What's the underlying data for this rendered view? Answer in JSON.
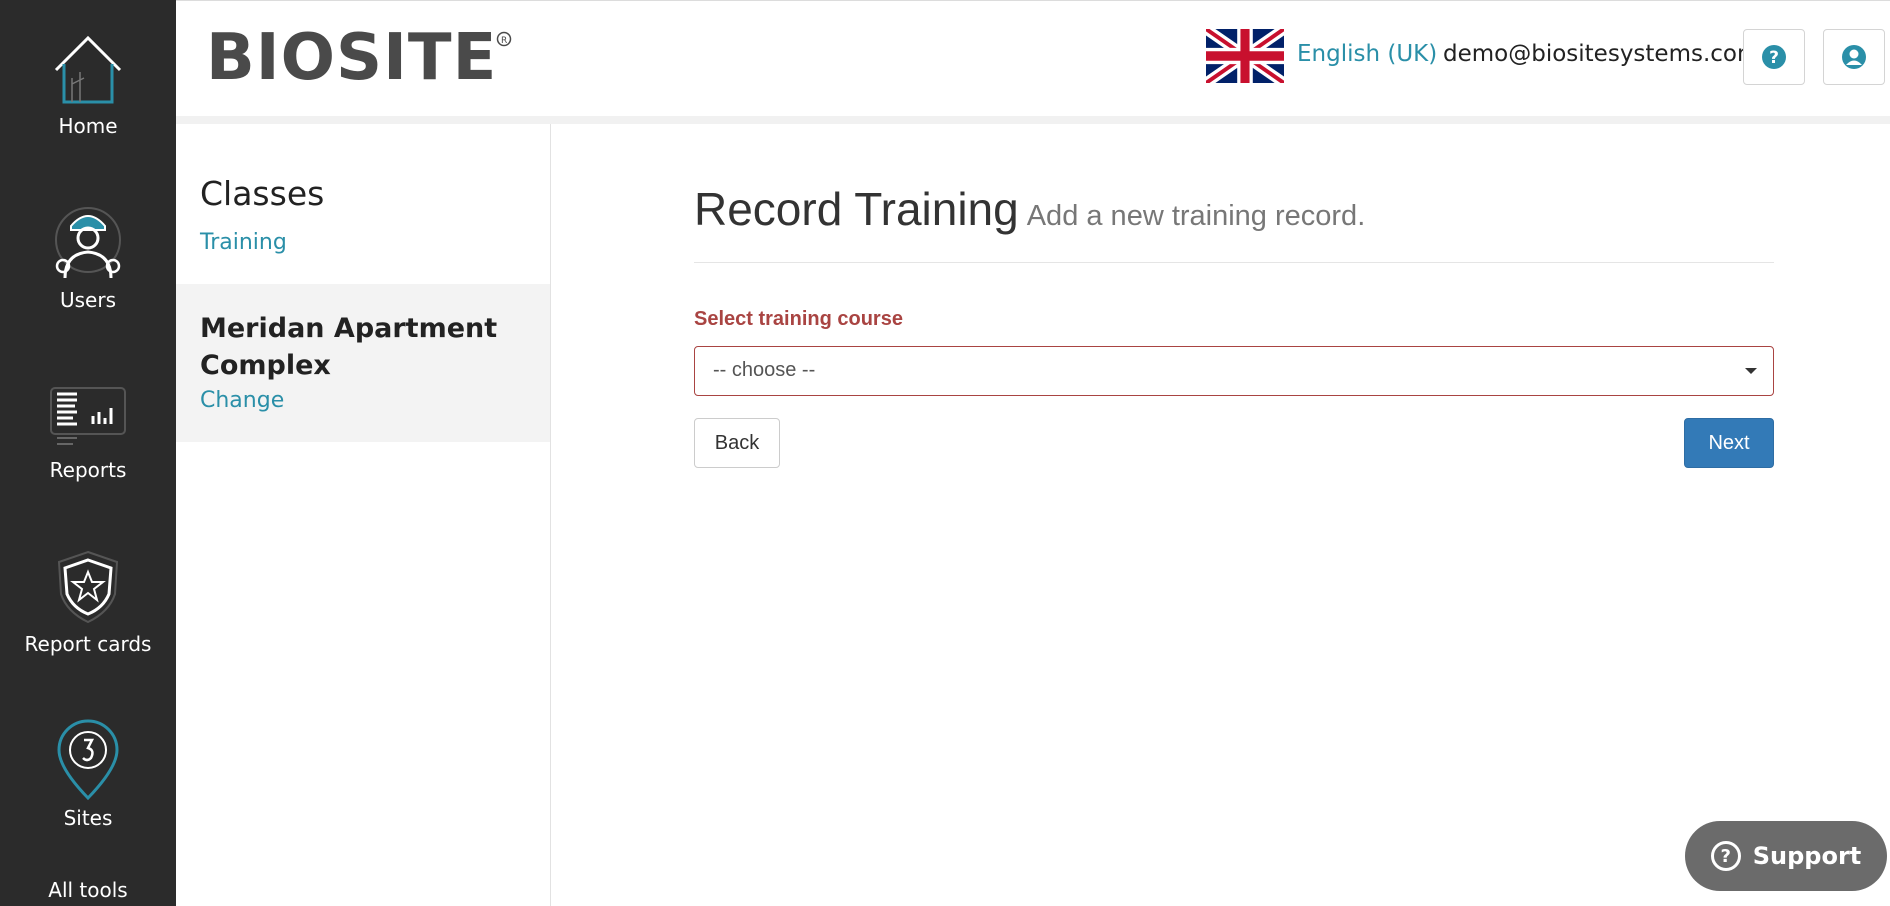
{
  "nav": {
    "items": [
      {
        "label": "Home",
        "icon": "home-icon"
      },
      {
        "label": "Users",
        "icon": "worker-icon"
      },
      {
        "label": "Reports",
        "icon": "reports-icon"
      },
      {
        "label": "Report cards",
        "icon": "star-shield-icon"
      },
      {
        "label": "Sites",
        "icon": "crane-hook-pin-icon"
      },
      {
        "label": "All tools",
        "icon": "tools-icon"
      }
    ]
  },
  "header": {
    "logo_text": "BIOSITE",
    "language": "English (UK)",
    "user_email": "demo@biositesystems.com",
    "help_icon": "question-circle-icon",
    "profile_icon": "user-circle-icon"
  },
  "sidebar": {
    "section_title": "Classes",
    "section_link": "Training",
    "site_name": "Meridan Apartment Complex",
    "change_link": "Change"
  },
  "main": {
    "title": "Record Training",
    "subtitle": "Add a new training record.",
    "field_label": "Select training course",
    "select_value": "-- choose --",
    "back_label": "Back",
    "next_label": "Next"
  },
  "support": {
    "label": "Support"
  },
  "colors": {
    "nav_bg": "#2b2b2b",
    "link": "#2a8fa8",
    "error": "#a94442",
    "primary": "#337ab7"
  }
}
